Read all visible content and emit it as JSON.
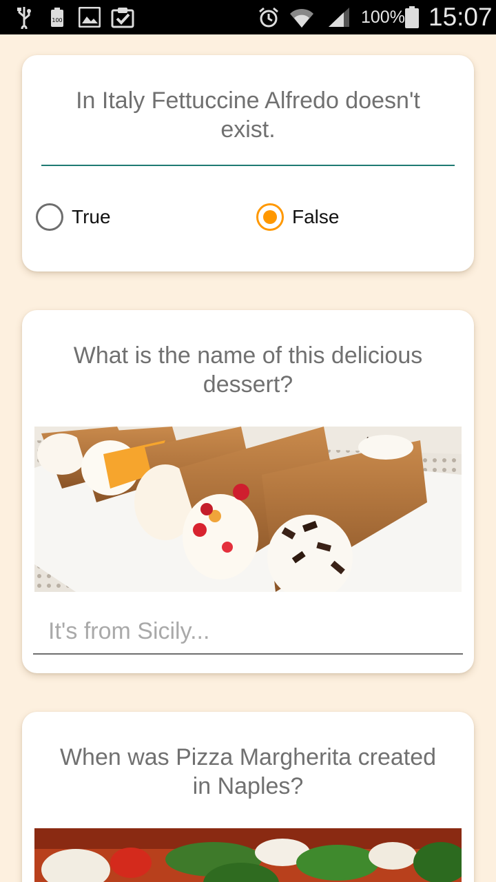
{
  "status_bar": {
    "battery_percent": "100%",
    "time": "15:07",
    "icons": [
      "usb-icon",
      "battery-saver-icon",
      "gallery-icon",
      "clipboard-check-icon",
      "alarm-icon",
      "wifi-icon",
      "signal-icon",
      "battery-icon"
    ]
  },
  "questions": [
    {
      "text": "In Italy Fettuccine Alfredo doesn't exist.",
      "type": "true-false",
      "options": [
        "True",
        "False"
      ],
      "selected": "False"
    },
    {
      "text": "What is the name of this delicious dessert?",
      "type": "image-text",
      "image": "cannoli-photo",
      "answer_placeholder": "It's from Sicily...",
      "answer_value": ""
    },
    {
      "text": "When was Pizza Margherita created in Naples?",
      "type": "image",
      "image": "pizza-margherita-photo"
    }
  ],
  "colors": {
    "background": "#fdf0df",
    "accent": "#ff9800",
    "underline_teal": "#1e7a72"
  }
}
